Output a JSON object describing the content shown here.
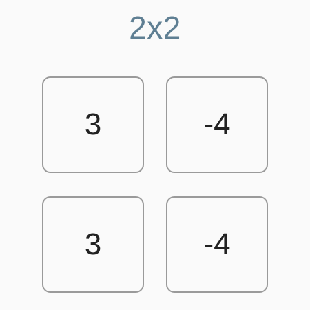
{
  "title": "2x2",
  "matrix": {
    "cells": [
      [
        "3",
        "-4"
      ],
      [
        "3",
        "-4"
      ]
    ]
  },
  "colors": {
    "title": "#5f7f93",
    "cell_border": "#9a9a9a",
    "cell_text": "#222222",
    "background": "#fafafa"
  }
}
